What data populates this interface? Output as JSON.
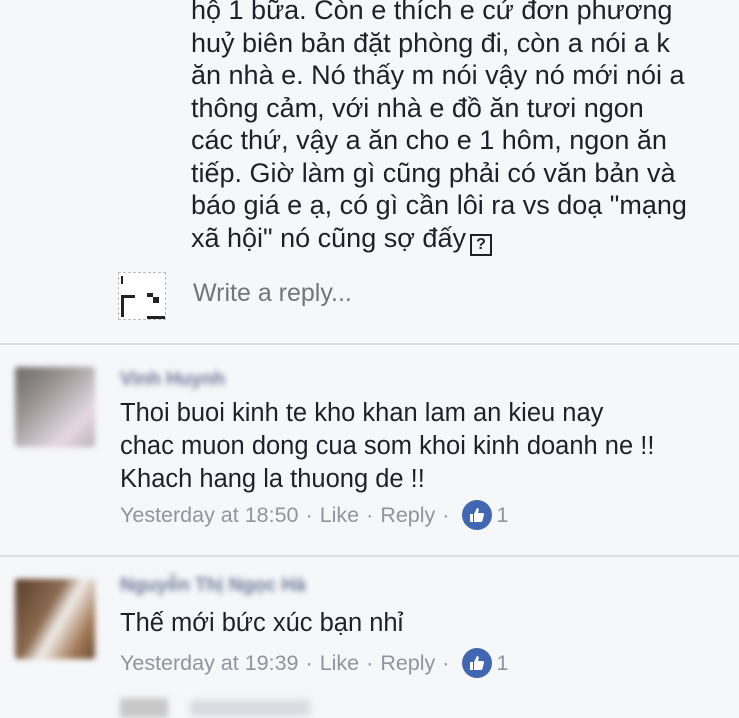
{
  "reply_thread": {
    "lines": [
      "hộ 1 bữa. Còn e thích e cứ đơn phương",
      "huỷ biên bản đặt phòng đi, còn a nói a k",
      "ăn nhà e. Nó thấy m nói vậy nó mới nói a",
      "thông cảm, với nhà e đồ ăn tươi ngon",
      "các thứ, vậy a ăn cho e 1 hôm, ngon ăn",
      "tiếp. Giờ làm gì cũng phải có văn bản và",
      "báo giá e ạ, có gì cần lôi ra vs doạ \"mạng",
      "xã hội\" nó cũng sợ đấy"
    ],
    "emoji_placeholder": "?",
    "reply_placeholder": "Write a reply..."
  },
  "comments": [
    {
      "author": "Vinh Huynh",
      "lines": [
        "Thoi buoi kinh te kho khan lam an kieu nay",
        "chac muon dong cua som khoi kinh doanh ne !!",
        "Khach hang la thuong de !!"
      ],
      "time": "Yesterday at 18:50",
      "like_label": "Like",
      "reply_label": "Reply",
      "like_count": "1"
    },
    {
      "author": "Nguyễn Thị Ngọc Hà",
      "lines": [
        "Thế mới bức xúc bạn nhỉ"
      ],
      "time": "Yesterday at 19:39",
      "like_label": "Like",
      "reply_label": "Reply",
      "like_count": "1"
    }
  ],
  "colors": {
    "background": "#f6f7f9",
    "text": "#1d2129",
    "meta": "#90949c",
    "like_badge": "#4267b2",
    "author_name": "#6b7a99"
  },
  "icons": {
    "like_badge": "thumbs-up-icon",
    "emoji": "unknown-glyph-box"
  }
}
